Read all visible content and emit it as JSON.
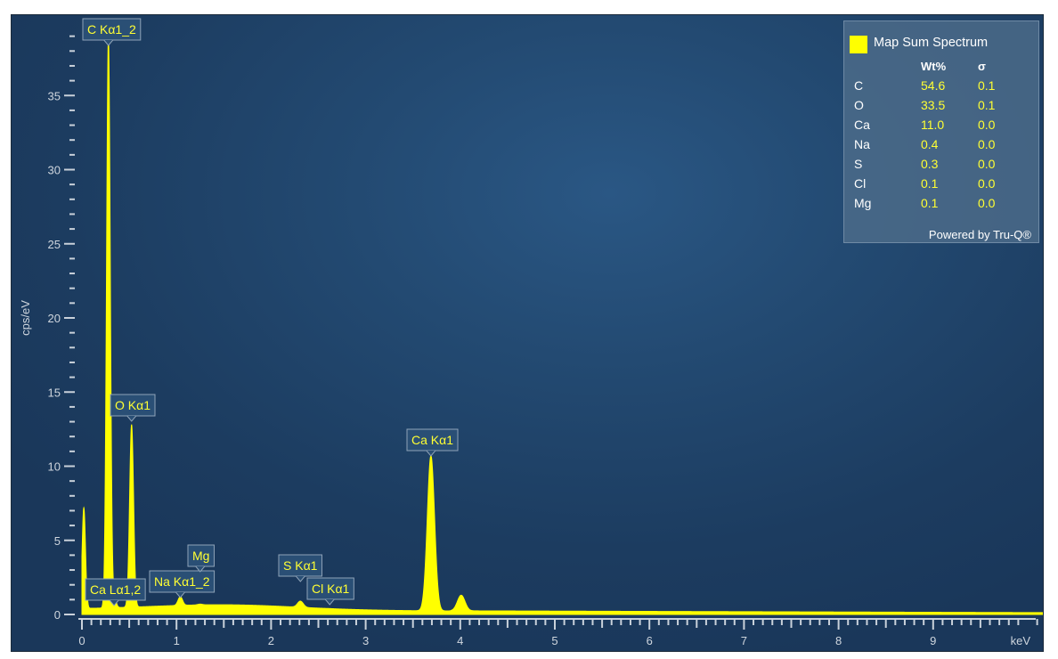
{
  "chart_data": {
    "type": "area",
    "title": "",
    "xlabel": "keV",
    "ylabel": "cps/eV",
    "xlim": [
      0,
      10.25
    ],
    "ylim": [
      0,
      40
    ],
    "x_ticks": [
      "0",
      "1",
      "2",
      "3",
      "4",
      "5",
      "6",
      "7",
      "8",
      "9"
    ],
    "y_ticks": [
      "0",
      "5",
      "10",
      "15",
      "20",
      "25",
      "30",
      "35"
    ],
    "grid": false,
    "series": [
      {
        "name": "Map Sum Spectrum",
        "color": "#ffff00",
        "peaks": [
          {
            "x": 0.02,
            "y": 7.2
          },
          {
            "x": 0.28,
            "y": 39.0
          },
          {
            "x": 0.34,
            "y": 1.2
          },
          {
            "x": 0.525,
            "y": 12.8
          },
          {
            "x": 1.04,
            "y": 1.2
          },
          {
            "x": 1.25,
            "y": 0.7
          },
          {
            "x": 2.31,
            "y": 0.9
          },
          {
            "x": 2.62,
            "y": 0.4
          },
          {
            "x": 3.69,
            "y": 10.7
          },
          {
            "x": 4.01,
            "y": 1.3
          }
        ]
      }
    ],
    "peak_labels": [
      {
        "text": "C Kα1_2",
        "x": 0.28,
        "y": 39.0
      },
      {
        "text": "O Kα1",
        "x": 0.525,
        "y": 12.8
      },
      {
        "text": "Ca Lα1,2",
        "x": 0.34,
        "y": 1.2
      },
      {
        "text": "Na Kα1_2",
        "x": 1.04,
        "y": 1.2
      },
      {
        "text": "Mg",
        "x": 1.25,
        "y": 0.7
      },
      {
        "text": "S Kα1",
        "x": 2.31,
        "y": 0.9
      },
      {
        "text": "Cl Kα1",
        "x": 2.62,
        "y": 0.4
      },
      {
        "text": "Ca Kα1",
        "x": 3.69,
        "y": 10.7
      }
    ],
    "legend": {
      "title": "Map Sum Spectrum",
      "placement": "top-right",
      "headers": [
        "Wt%",
        "σ"
      ],
      "rows": [
        {
          "element": "C",
          "wt": "54.6",
          "sigma": "0.1"
        },
        {
          "element": "O",
          "wt": "33.5",
          "sigma": "0.1"
        },
        {
          "element": "Ca",
          "wt": "11.0",
          "sigma": "0.0"
        },
        {
          "element": "Na",
          "wt": "0.4",
          "sigma": "0.0"
        },
        {
          "element": "S",
          "wt": "0.3",
          "sigma": "0.0"
        },
        {
          "element": "Cl",
          "wt": "0.1",
          "sigma": "0.0"
        },
        {
          "element": "Mg",
          "wt": "0.1",
          "sigma": "0.0"
        }
      ],
      "footer": "Powered by Tru-Q®"
    }
  }
}
